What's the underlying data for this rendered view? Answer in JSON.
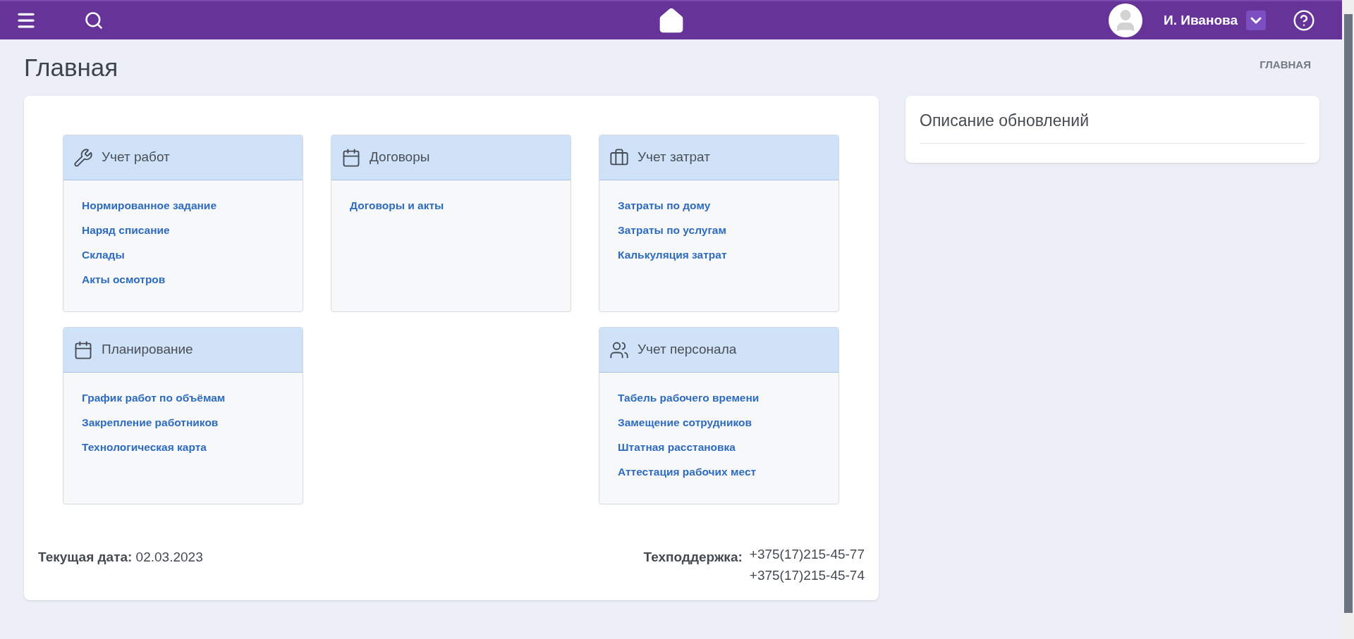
{
  "topbar": {
    "user_name": "И. Иванова"
  },
  "page": {
    "title": "Главная",
    "breadcrumb": "ГЛАВНАЯ"
  },
  "module_columns": [
    [
      {
        "title": "Учет работ",
        "links": [
          "Нормированное задание",
          "Наряд списание",
          "Склады",
          "Акты осмотров"
        ]
      },
      {
        "title": "Планирование",
        "links": [
          "График работ по объёмам",
          "Закрепление работников",
          "Технологическая карта"
        ]
      }
    ],
    [
      {
        "title": "Договоры",
        "links": [
          "Договоры и акты"
        ]
      }
    ],
    [
      {
        "title": "Учет затрат",
        "links": [
          "Затраты по дому",
          "Затраты по услугам",
          "Калькуляция затрат"
        ]
      },
      {
        "title": "Учет персонала",
        "links": [
          "Табель рабочего времени",
          "Замещение сотрудников",
          "Штатная расстановка",
          "Аттестация рабочих мест"
        ]
      }
    ]
  ],
  "footer": {
    "date_label": "Текущая дата:",
    "date": "02.03.2023",
    "support_label": "Техподдержка:",
    "phones": [
      "+375(17)215-45-77",
      "+375(17)215-45-74"
    ]
  },
  "updates": {
    "title": "Описание обновлений"
  }
}
